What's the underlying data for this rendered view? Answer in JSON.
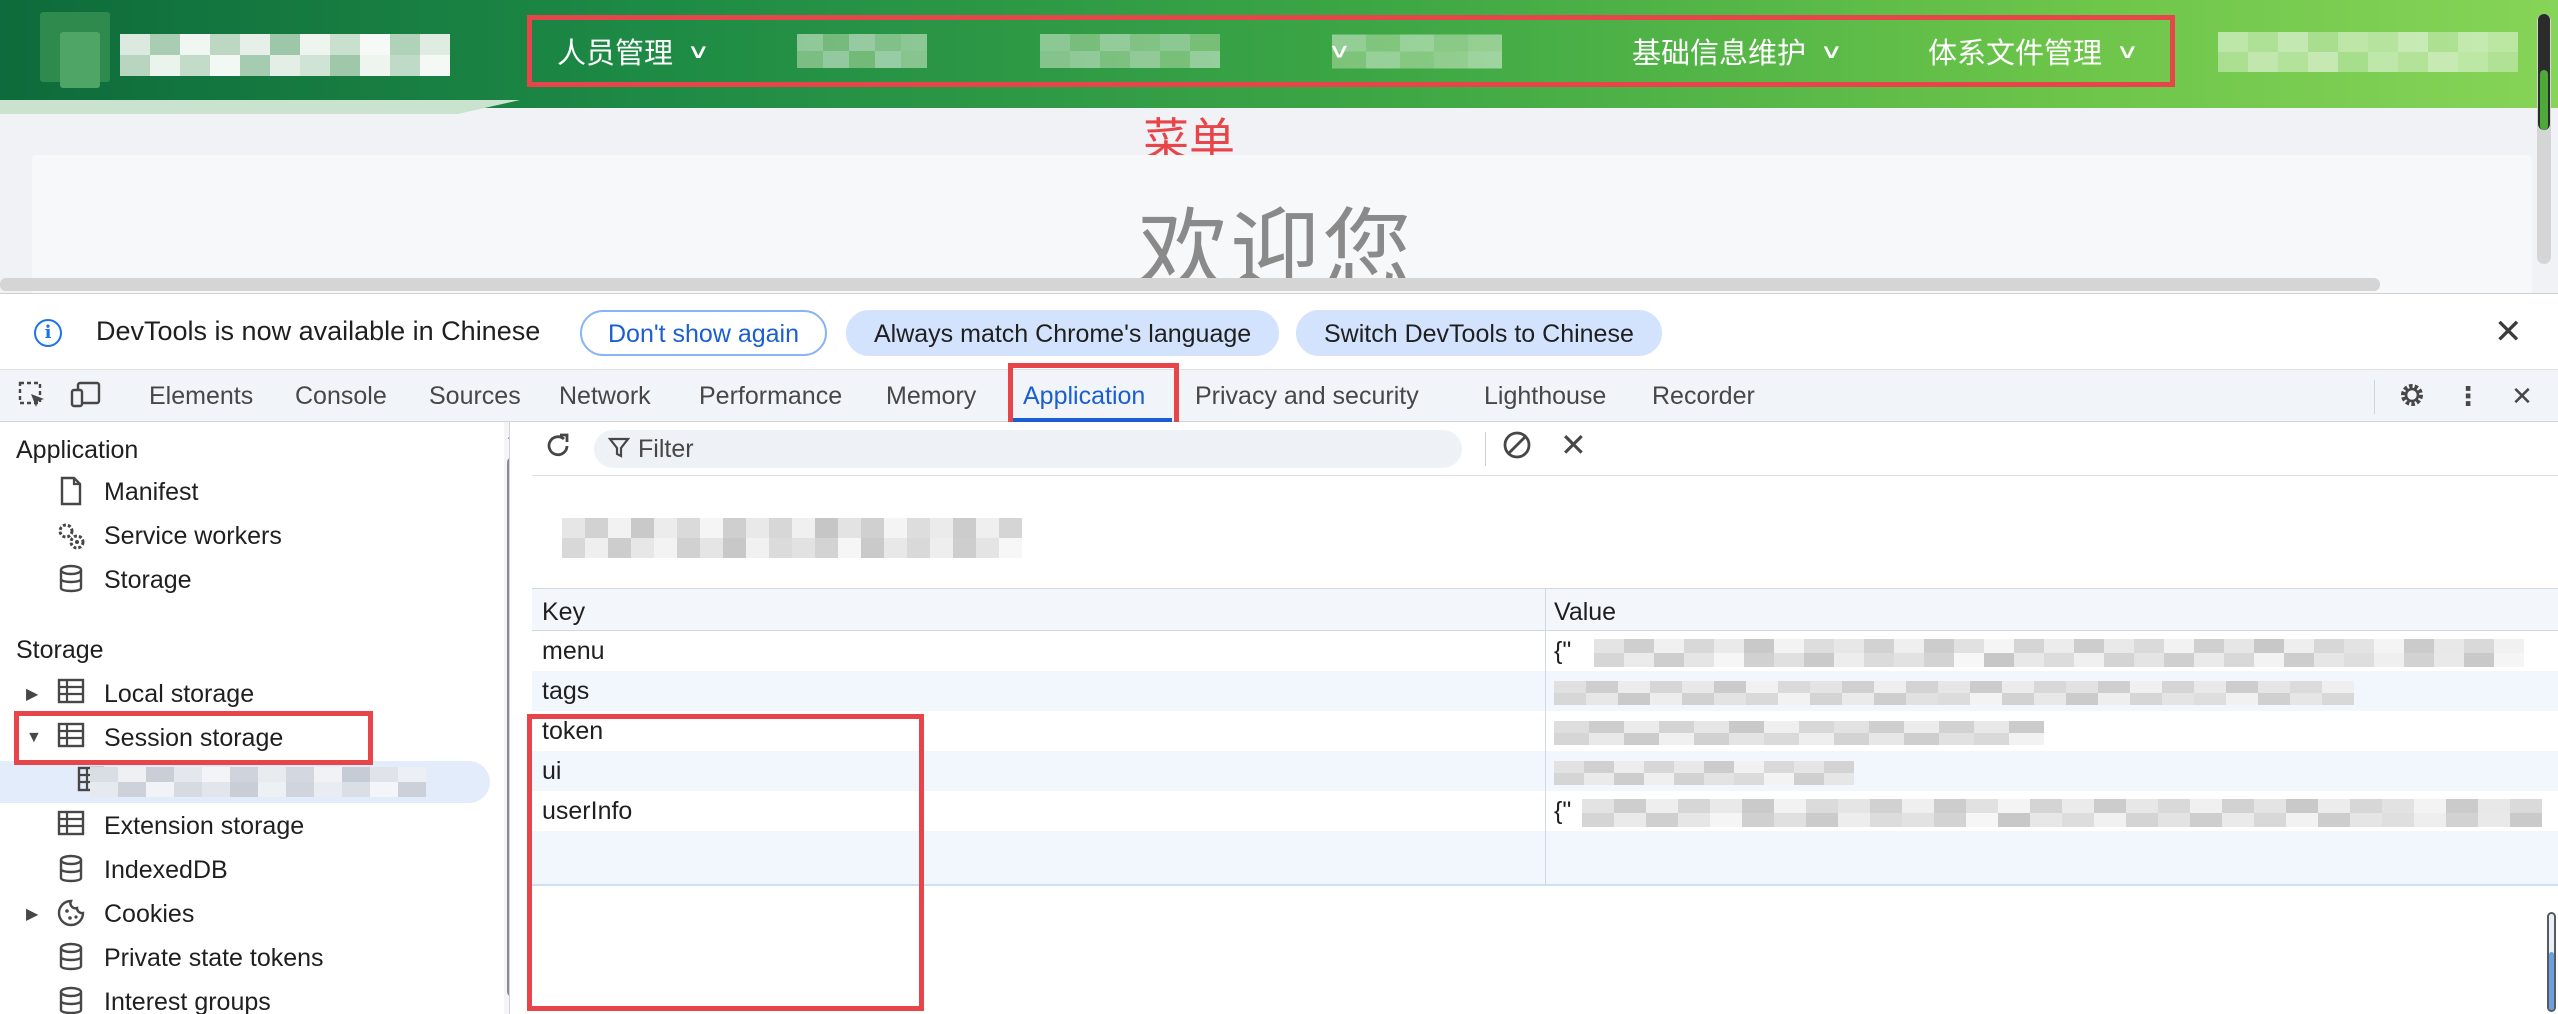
{
  "webpage": {
    "nav_menu": [
      {
        "label": "人员管理",
        "chevron": "chevron-down-icon"
      },
      {
        "label": "",
        "chevron": ""
      },
      {
        "label": "",
        "chevron": ""
      },
      {
        "label": "",
        "chevron": "chevron-down-icon"
      },
      {
        "label": "基础信息维护",
        "chevron": "chevron-down-icon"
      },
      {
        "label": "体系文件管理",
        "chevron": "chevron-down-icon"
      }
    ],
    "menu_annotation": "菜单",
    "welcome": "欢迎您",
    "colors": {
      "annotation": "#e8454b",
      "nav_start": "#0e6b3b",
      "nav_end": "#86d458"
    }
  },
  "devtools": {
    "infobar": {
      "message": "DevTools is now available in Chinese",
      "dont_show_again": "Don't show again",
      "always_match": "Always match Chrome's language",
      "switch_to_chinese": "Switch DevTools to Chinese",
      "icon": "info-icon"
    },
    "tabs": [
      "Elements",
      "Console",
      "Sources",
      "Network",
      "Performance",
      "Memory",
      "Application",
      "Privacy and security",
      "Lighthouse",
      "Recorder"
    ],
    "active_tab": "Application",
    "sidebar": {
      "application_heading": "Application",
      "application_items": [
        {
          "label": "Manifest",
          "icon": "file-icon"
        },
        {
          "label": "Service workers",
          "icon": "gears-icon"
        },
        {
          "label": "Storage",
          "icon": "database-icon"
        }
      ],
      "storage_heading": "Storage",
      "storage_items": [
        {
          "label": "Local storage",
          "icon": "grid-icon",
          "expander": "collapsed"
        },
        {
          "label": "Session storage",
          "icon": "grid-icon",
          "expander": "expanded"
        },
        {
          "label": "Extension storage",
          "icon": "grid-icon",
          "expander": ""
        },
        {
          "label": "IndexedDB",
          "icon": "database-icon",
          "expander": ""
        },
        {
          "label": "Cookies",
          "icon": "cookie-icon",
          "expander": "collapsed"
        },
        {
          "label": "Private state tokens",
          "icon": "database-icon",
          "expander": ""
        },
        {
          "label": "Interest groups",
          "icon": "database-icon",
          "expander": ""
        }
      ]
    },
    "storage_panel": {
      "filter_placeholder": "Filter",
      "columns": {
        "key": "Key",
        "value": "Value"
      },
      "rows": [
        {
          "key": "menu",
          "value": "{\""
        },
        {
          "key": "tags",
          "value": ""
        },
        {
          "key": "token",
          "value": ""
        },
        {
          "key": "ui",
          "value": ""
        },
        {
          "key": "userInfo",
          "value": "{\""
        }
      ]
    }
  }
}
